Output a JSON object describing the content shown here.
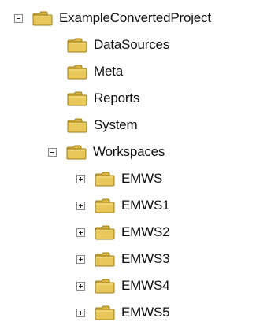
{
  "tree": {
    "root": {
      "label": "ExampleConvertedProject",
      "expanded": true,
      "icon": "folder-icon",
      "children": [
        {
          "label": "DataSources",
          "icon": "folder-icon"
        },
        {
          "label": "Meta",
          "icon": "folder-icon"
        },
        {
          "label": "Reports",
          "icon": "folder-icon"
        },
        {
          "label": "System",
          "icon": "folder-icon"
        },
        {
          "label": "Workspaces",
          "expanded": true,
          "icon": "folder-icon",
          "children": [
            {
              "label": "EMWS",
              "expanded": false,
              "icon": "folder-icon"
            },
            {
              "label": "EMWS1",
              "expanded": false,
              "icon": "folder-icon"
            },
            {
              "label": "EMWS2",
              "expanded": false,
              "icon": "folder-icon"
            },
            {
              "label": "EMWS3",
              "expanded": false,
              "icon": "folder-icon"
            },
            {
              "label": "EMWS4",
              "expanded": false,
              "icon": "folder-icon"
            },
            {
              "label": "EMWS5",
              "expanded": false,
              "icon": "folder-icon"
            }
          ]
        }
      ]
    }
  },
  "colors": {
    "background": "#ffffff",
    "folder": "#e8c85a",
    "folder_tab": "#d8b548",
    "folder_outline": "#9f7d12",
    "text": "#111111"
  }
}
